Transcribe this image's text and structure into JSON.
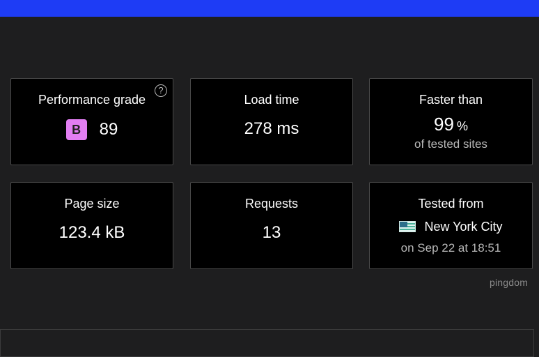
{
  "colors": {
    "top_bar": "#1e3cf5",
    "background": "#1e1e1f",
    "card_bg": "#000000",
    "grade_badge": "#e27ef2"
  },
  "cards": {
    "performance": {
      "label": "Performance grade",
      "grade_letter": "B",
      "score": "89",
      "help_icon": "?"
    },
    "load_time": {
      "label": "Load time",
      "value": "278 ms"
    },
    "faster_than": {
      "label": "Faster than",
      "value": "99",
      "unit": "%",
      "sub": "of tested sites"
    },
    "page_size": {
      "label": "Page size",
      "value": "123.4 kB"
    },
    "requests": {
      "label": "Requests",
      "value": "13"
    },
    "tested_from": {
      "label": "Tested from",
      "location": "New York City",
      "flag_icon": "us-flag-icon",
      "time": "on Sep 22 at 18:51"
    }
  },
  "branding": {
    "logo_text": "pingdom"
  }
}
